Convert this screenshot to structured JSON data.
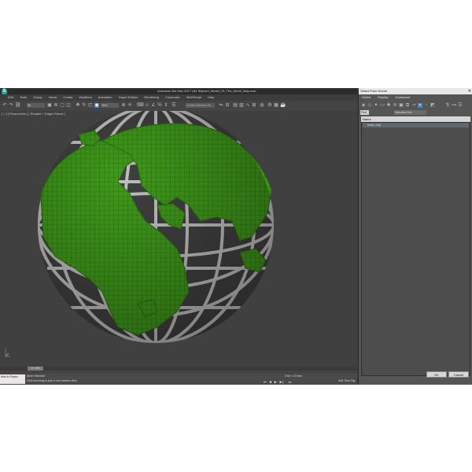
{
  "app": {
    "logo_letter": "S",
    "title": "Autodesk 3ds Max 2017 x64   Stylized_Model_Of_The_World_Map.max"
  },
  "menu": [
    "Edit",
    "Tools",
    "Group",
    "Views",
    "Create",
    "Modifiers",
    "Animation",
    "Graph Editors",
    "Rendering",
    "Customize",
    "MAXScript",
    "Help"
  ],
  "toolbar": {
    "filter_value": "All",
    "coord_value": "View",
    "selection_set_placeholder": "Create Selection Se"
  },
  "viewport": {
    "label": "[ + ] [ Perspective ] [ Shaded + Edged Faces ]"
  },
  "colors": {
    "land": "#3f9a1a",
    "grid": "#cfcfcf",
    "background": "#404040"
  },
  "scene_explorer": {
    "title": "Select From Scene",
    "tabs": [
      "Select",
      "Display",
      "Customize"
    ],
    "find_label": "Find",
    "selection_set_label": "Selection Set:",
    "column_header": "Name",
    "items": [
      "world_map"
    ],
    "ok_label": "OK",
    "cancel_label": "Cancel"
  },
  "timeline": {
    "frame_label": "0 / 100"
  },
  "status": {
    "maxscript_label": "Max to Physic",
    "selection_text": "None Selected",
    "prompt_text": "Click and drag to pan a non-camera view",
    "grid_text": "Grid = 10,0cm",
    "add_time_tag": "Add Time Tag"
  }
}
